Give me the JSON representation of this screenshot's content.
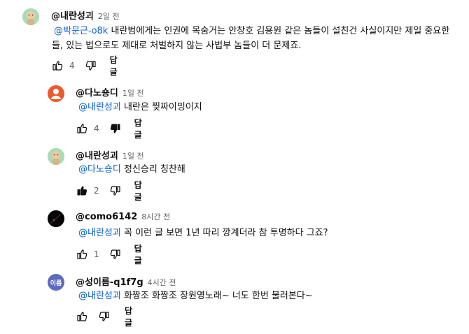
{
  "comments": [
    {
      "author": "@내란성괴",
      "time": "2일 전",
      "mention": "@박문근-o8k",
      "text_line1": " 내란범에게는 인권에 목숨거는 안창호 김용원 같은 놈들이 설친건 사실이지만 제일 중요한",
      "text_line2": "들, 있는 법으로도 제대로 처벌하지 않는 사법부 놈들이 더 문제죠.",
      "likes": "4",
      "reply_label": "답글"
    },
    {
      "author": "@다노숑디",
      "time": "1일 전",
      "mention": "@내란성괴",
      "text": " 내란은 찢짜이밍이지",
      "likes": "4",
      "reply_label": "답글"
    },
    {
      "author": "@내란성괴",
      "time": "1일 전",
      "mention": "@다노숑디",
      "text": " 정신승리 칭찬해",
      "likes": "2",
      "reply_label": "답글"
    },
    {
      "author": "@como6142",
      "time": "8시간 전",
      "mention": "@내란성괴",
      "text": " 꼭 이런 글 보면 1년 따리 깡계더라 참 투명하다 그죠?",
      "likes": "1",
      "reply_label": "답글"
    },
    {
      "author": "@성이름-q1f7g",
      "avatar_text": "이름",
      "time": "4시간 전",
      "mention": "@내란성괴",
      "text": " 화짱조 화짱조 장원영노래~ 너도 한번 불러본다~",
      "likes": "",
      "reply_label": "답글"
    }
  ],
  "colors": {
    "mention": "#065fd4",
    "avatar_orange": "#ea5a2d",
    "avatar_purple": "#5c6bc0"
  }
}
